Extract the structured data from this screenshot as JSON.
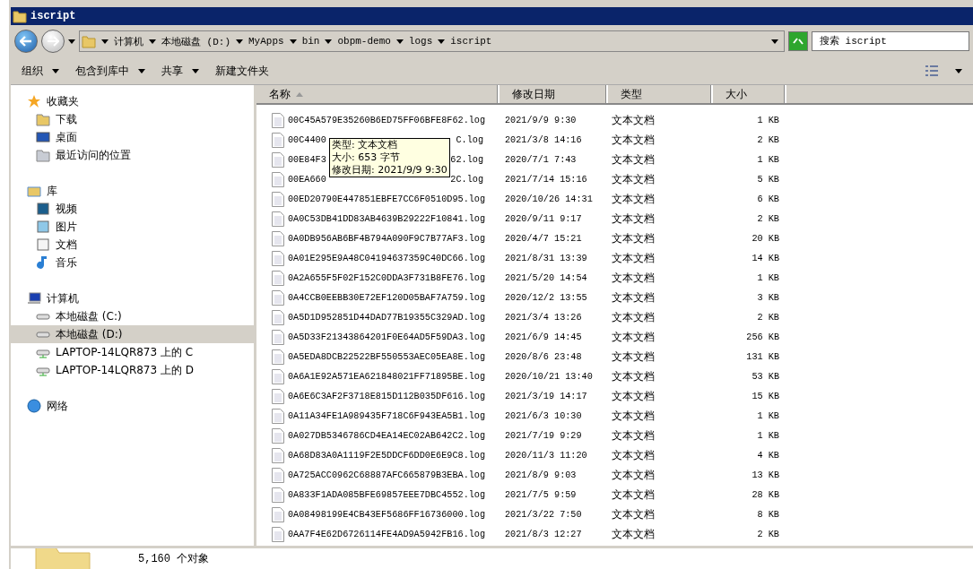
{
  "window": {
    "title": "iscript"
  },
  "address": {
    "segments": [
      "计算机",
      "本地磁盘 (D:)",
      "MyApps",
      "bin",
      "obpm-demo",
      "logs",
      "iscript"
    ]
  },
  "search": {
    "placeholder": "搜索 iscript"
  },
  "toolbar": [
    {
      "label": "组织",
      "dropdown": true
    },
    {
      "label": "包含到库中",
      "dropdown": true
    },
    {
      "label": "共享",
      "dropdown": true
    },
    {
      "label": "新建文件夹",
      "dropdown": false
    }
  ],
  "sidebar": {
    "groups": [
      {
        "label": "收藏夹",
        "selected": false,
        "children": [
          {
            "label": "下载",
            "selected": false
          },
          {
            "label": "桌面",
            "selected": false
          },
          {
            "label": "最近访问的位置",
            "selected": false
          }
        ]
      },
      {
        "label": "库",
        "selected": false,
        "children": [
          {
            "label": "视频",
            "selected": false
          },
          {
            "label": "图片",
            "selected": false
          },
          {
            "label": "文档",
            "selected": false
          },
          {
            "label": "音乐",
            "selected": false
          }
        ]
      },
      {
        "label": "计算机",
        "selected": false,
        "children": [
          {
            "label": "本地磁盘 (C:)",
            "selected": false
          },
          {
            "label": "本地磁盘 (D:)",
            "selected": true
          },
          {
            "label": "LAPTOP-14LQR873 上的 C",
            "selected": false
          },
          {
            "label": "LAPTOP-14LQR873 上的 D",
            "selected": false
          }
        ]
      },
      {
        "label": "网络",
        "selected": false
      }
    ]
  },
  "table": {
    "columns": [
      "名称",
      "修改日期",
      "类型",
      "大小"
    ],
    "rows": [
      {
        "name": "00C45A579E35260B6ED75FF06BFE8F62.log",
        "date": "2021/9/9 9:30",
        "type": "文本文档",
        "size": "1 KB"
      },
      {
        "name": "00C4400",
        "name_end": "C.log",
        "date": "2021/3/8 14:16",
        "type": "文本文档",
        "size": "2 KB"
      },
      {
        "name": "00E84F3",
        "name_end": "62.log",
        "date": "2020/7/1 7:43",
        "type": "文本文档",
        "size": "1 KB"
      },
      {
        "name": "00EA660",
        "name_end": "2C.log",
        "date": "2021/7/14 15:16",
        "type": "文本文档",
        "size": "5 KB"
      },
      {
        "name": "00ED20790E447851EBFE7CC6F0510D95.log",
        "date": "2020/10/26 14:31",
        "type": "文本文档",
        "size": "6 KB"
      },
      {
        "name": "0A0C53DB41DD83AB4639B29222F10841.log",
        "date": "2020/9/11 9:17",
        "type": "文本文档",
        "size": "2 KB"
      },
      {
        "name": "0A0DB956AB6BF4B794A090F9C7B77AF3.log",
        "date": "2020/4/7 15:21",
        "type": "文本文档",
        "size": "20 KB"
      },
      {
        "name": "0A01E295E9A48C04194637359C40DC66.log",
        "date": "2021/8/31 13:39",
        "type": "文本文档",
        "size": "14 KB"
      },
      {
        "name": "0A2A655F5F02F152C0DDA3F731B8FE76.log",
        "date": "2021/5/20 14:54",
        "type": "文本文档",
        "size": "1 KB"
      },
      {
        "name": "0A4CCB0EEBB30E72EF120D05BAF7A759.log",
        "date": "2020/12/2 13:55",
        "type": "文本文档",
        "size": "3 KB"
      },
      {
        "name": "0A5D1D952851D44DAD77B19355C329AD.log",
        "date": "2021/3/4 13:26",
        "type": "文本文档",
        "size": "2 KB"
      },
      {
        "name": "0A5D33F21343864201F0E64AD5F59DA3.log",
        "date": "2021/6/9 14:45",
        "type": "文本文档",
        "size": "256 KB"
      },
      {
        "name": "0A5EDA8DCB22522BF550553AEC05EA8E.log",
        "date": "2020/8/6 23:48",
        "type": "文本文档",
        "size": "131 KB"
      },
      {
        "name": "0A6A1E92A571EA621848021FF71895BE.log",
        "date": "2020/10/21 13:40",
        "type": "文本文档",
        "size": "53 KB"
      },
      {
        "name": "0A6E6C3AF2F3718E815D112B035DF616.log",
        "date": "2021/3/19 14:17",
        "type": "文本文档",
        "size": "15 KB"
      },
      {
        "name": "0A11A34FE1A989435F718C6F943EA5B1.log",
        "date": "2021/6/3 10:30",
        "type": "文本文档",
        "size": "1 KB"
      },
      {
        "name": "0A027DB5346786CD4EA14EC02AB642C2.log",
        "date": "2021/7/19 9:29",
        "type": "文本文档",
        "size": "1 KB"
      },
      {
        "name": "0A68D83A0A1119F2E5DDCF6DD0E6E9C8.log",
        "date": "2020/11/3 11:20",
        "type": "文本文档",
        "size": "4 KB"
      },
      {
        "name": "0A725ACC0962C68887AFC665879B3EBA.log",
        "date": "2021/8/9 9:03",
        "type": "文本文档",
        "size": "13 KB"
      },
      {
        "name": "0A833F1ADA085BFE69857EEE7DBC4552.log",
        "date": "2021/7/5 9:59",
        "type": "文本文档",
        "size": "28 KB"
      },
      {
        "name": "0A08498199E4CB43EF5686FF16736000.log",
        "date": "2021/3/22 7:50",
        "type": "文本文档",
        "size": "8 KB"
      },
      {
        "name": "0AA7F4E62D6726114FE4AD9A5942FB16.log",
        "date": "2021/8/3 12:27",
        "type": "文本文档",
        "size": "2 KB"
      }
    ]
  },
  "tooltip": {
    "lines": [
      "类型: 文本文档",
      "大小: 653 字节",
      "修改日期: 2021/9/9 9:30"
    ]
  },
  "status_bar": {
    "count": "5,160 个对象"
  }
}
